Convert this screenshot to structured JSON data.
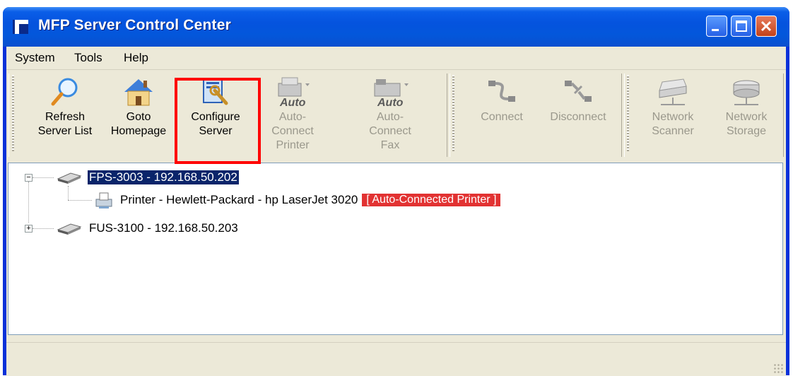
{
  "window": {
    "title": "MFP Server Control Center"
  },
  "menu": [
    {
      "label": "System"
    },
    {
      "label": "Tools"
    },
    {
      "label": "Help"
    }
  ],
  "toolbar": {
    "refresh": {
      "line1": "Refresh",
      "line2": "Server List",
      "icon": "magnifier-icon"
    },
    "homepage": {
      "line1": "Goto",
      "line2": "Homepage",
      "icon": "house-icon"
    },
    "configure": {
      "line1": "Configure",
      "line2": "Server",
      "icon": "configure-server-icon"
    },
    "auto_printer": {
      "line1": "Auto-Connect",
      "line2": "Printer",
      "icon": "auto-printer-icon",
      "overlay": "Auto"
    },
    "auto_fax": {
      "line1": "Auto-Connect",
      "line2": "Fax",
      "icon": "auto-fax-icon",
      "overlay": "Auto"
    },
    "connect": {
      "line1": "Connect",
      "icon": "connect-cable-icon"
    },
    "disconnect": {
      "line1": "Disconnect",
      "icon": "disconnect-cable-icon"
    },
    "scanner": {
      "line1": "Network",
      "line2": "Scanner",
      "icon": "network-scanner-icon"
    },
    "storage": {
      "line1": "Network",
      "line2": "Storage",
      "icon": "network-storage-icon"
    }
  },
  "tree": {
    "servers": [
      {
        "label": "FPS-3003 - 192.168.50.202",
        "expanded": true,
        "selected": true,
        "children": [
          {
            "label": "Printer - Hewlett-Packard - hp LaserJet 3020",
            "badge": "[ Auto-Connected Printer ]"
          }
        ]
      },
      {
        "label": "FUS-3100 - 192.168.50.203",
        "expanded": false
      }
    ]
  },
  "colors": {
    "titlebar": "#0553de",
    "highlight_box": "#ff0000",
    "badge_bg": "#e23232",
    "selection": "#0a246a"
  }
}
